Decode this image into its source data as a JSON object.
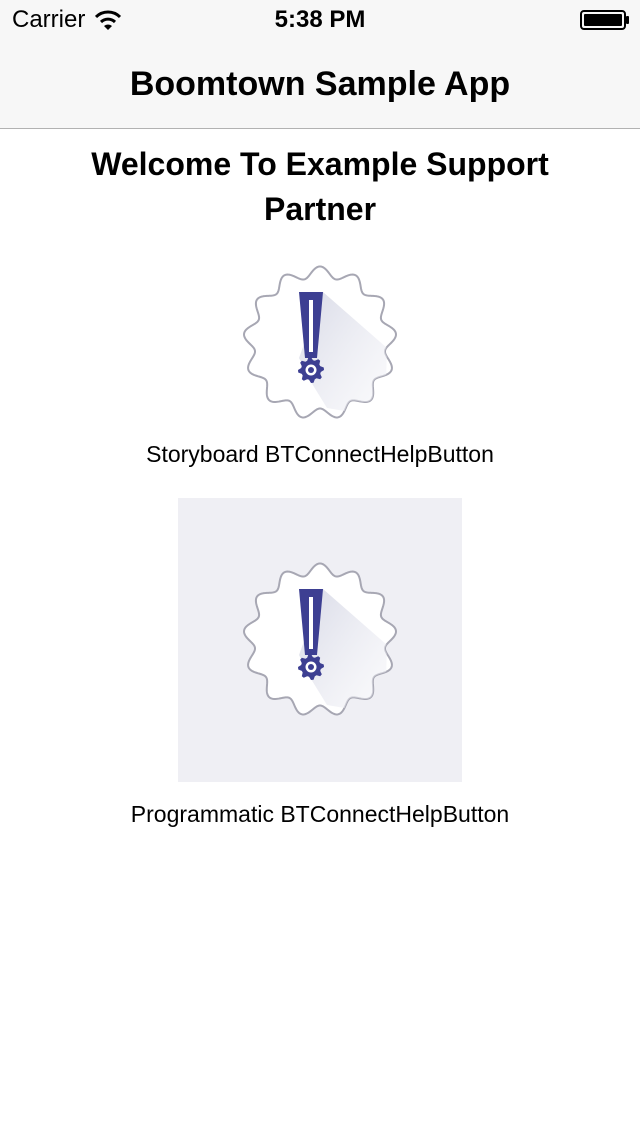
{
  "status_bar": {
    "carrier": "Carrier",
    "time": "5:38 PM",
    "icons": [
      "wifi-icon",
      "battery-icon"
    ]
  },
  "nav": {
    "title": "Boomtown Sample App"
  },
  "main": {
    "heading": "Welcome To Example Support Partner",
    "storyboard_caption": "Storyboard BTConnectHelpButton",
    "programmatic_caption": "Programmatic BTConnectHelpButton",
    "icons": [
      "help-badge-icon"
    ]
  },
  "colors": {
    "accent": "#3d3f92",
    "badge_outline": "#a7a7b3",
    "button_background": "#efeff4",
    "bar_background": "#f7f7f7"
  }
}
